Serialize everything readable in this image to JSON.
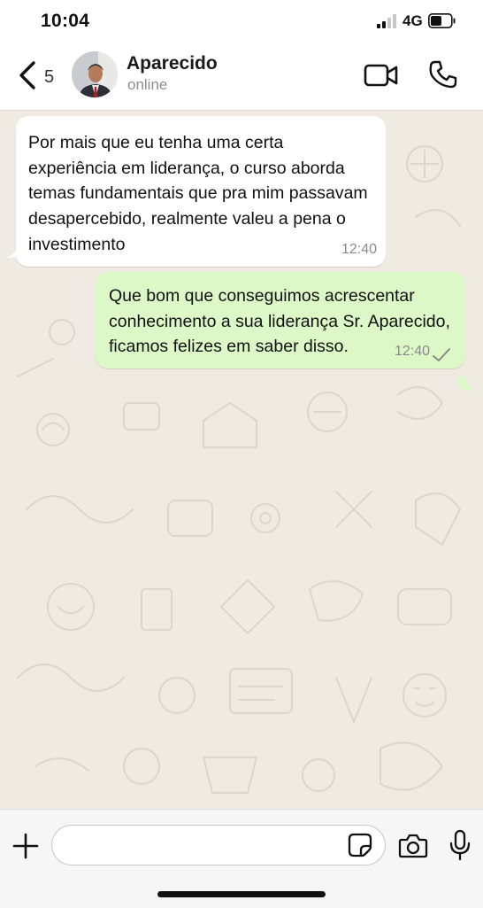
{
  "status_bar": {
    "time": "10:04",
    "network": "4G"
  },
  "header": {
    "unread_count": "5",
    "contact_name": "Aparecido",
    "contact_status": "online"
  },
  "messages": [
    {
      "direction": "incoming",
      "text": "Por mais que eu tenha uma certa experiência em liderança, o curso aborda temas fundamentais que pra mim passavam desapercebido, realmente valeu a pena o investimento",
      "time": "12:40"
    },
    {
      "direction": "outgoing",
      "text": "Que bom que conseguimos acrescentar conhecimento a sua liderança Sr. Aparecido, ficamos felizes em saber disso.",
      "time": "12:40",
      "status": "sent-check"
    }
  ],
  "input": {
    "placeholder": ""
  },
  "colors": {
    "chat_background": "#efeae2",
    "incoming_bubble": "#ffffff",
    "outgoing_bubble": "#dcf8c6",
    "timestamp": "#8a8a8a"
  },
  "icons": {
    "back": "chevron-left-icon",
    "video": "video-camera-icon",
    "call": "phone-icon",
    "plus": "plus-icon",
    "sticker": "sticker-icon",
    "camera": "camera-icon",
    "mic": "microphone-icon"
  }
}
